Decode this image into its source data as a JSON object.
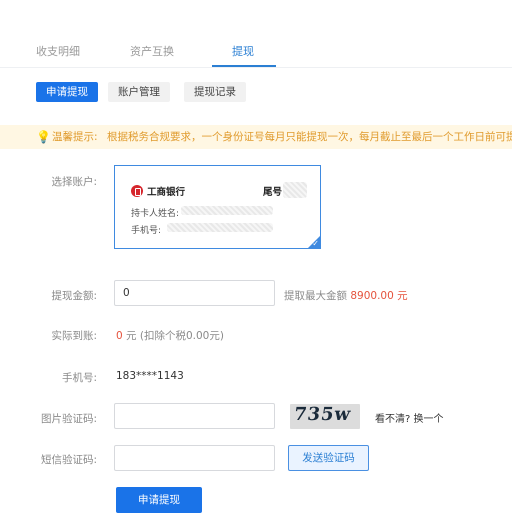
{
  "tabs": {
    "items": [
      "收支明细",
      "资产互换",
      "提现"
    ],
    "active_index": 2
  },
  "subtabs": [
    "申请提现",
    "账户管理",
    "提现记录"
  ],
  "notice": {
    "label": "温馨提示:",
    "text": "根据税务合规要求，一个身份证号每月只能提现一次，每月截止至最后一个工作日前可提"
  },
  "account": {
    "label": "选择账户:",
    "bank_name": "工商银行",
    "tail_label": "尾号",
    "holder_label": "持卡人姓名:",
    "phone_label": "手机号:"
  },
  "amount": {
    "label": "提现金额:",
    "value": "0",
    "max_prefix": "提取最大金额",
    "max_value": "8900.00",
    "max_unit": "元"
  },
  "actual": {
    "label": "实际到账:",
    "value": "0",
    "unit": "元",
    "tax_note": "(扣除个税0.00元)"
  },
  "phone": {
    "label": "手机号:",
    "value": "183****1143"
  },
  "image_code": {
    "label": "图片验证码:",
    "captcha_text": "735w",
    "refresh": "看不清? 换一个"
  },
  "sms_code": {
    "label": "短信验证码:",
    "send_label": "发送验证码"
  },
  "submit_label": "申请提现",
  "colors": {
    "primary": "#1a73e8",
    "link": "#2b7fd3",
    "notice_bg": "#fff7e3",
    "notice_text": "#e09b2d",
    "warning_red": "#e5533d"
  }
}
